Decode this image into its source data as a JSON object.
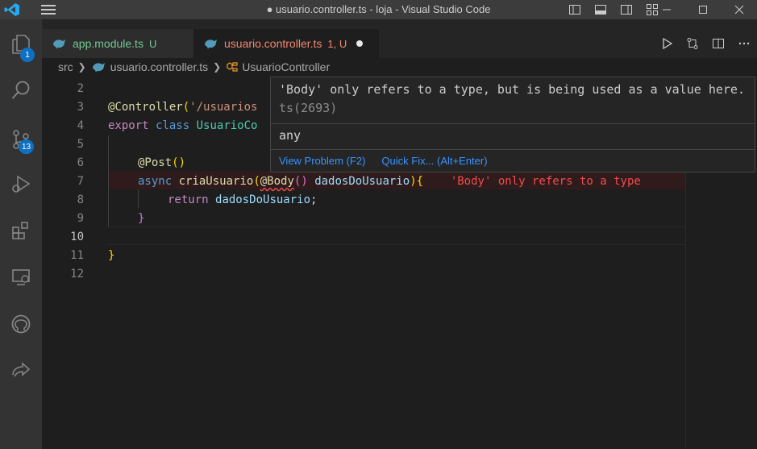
{
  "window": {
    "title": "● usuario.controller.ts - loja - Visual Studio Code"
  },
  "activity": {
    "explorer_badge": "1",
    "source_control_badge": "13"
  },
  "tabs": [
    {
      "name": "app.module.ts",
      "status": "U"
    },
    {
      "name": "usuario.controller.ts",
      "status": "1, U"
    }
  ],
  "breadcrumb": {
    "folder": "src",
    "file": "usuario.controller.ts",
    "symbol": "UsuarioController"
  },
  "editor": {
    "line_numbers": [
      "2",
      "3",
      "4",
      "5",
      "6",
      "7",
      "8",
      "9",
      "10",
      "11",
      "12"
    ],
    "active_line": "10",
    "line3": {
      "decorator": "@Controller",
      "open": "(",
      "string": "'/usuarios"
    },
    "line4": {
      "export": "export",
      "class": "class",
      "name": "UsuarioCo"
    },
    "line6": {
      "decorator": "@Post",
      "parens": "()"
    },
    "line7": {
      "async": "async",
      "fn": "criaUsuario",
      "open": "(",
      "decorator": "@Body",
      "dparens": "()",
      "param": "dadosDoUsuario",
      "close": ")",
      "brace": "{",
      "inline_error": "'Body' only refers to a type"
    },
    "line8": {
      "return": "return",
      "value": "dadosDoUsuario",
      "semi": ";"
    },
    "line9": {
      "brace": "}"
    },
    "line11": {
      "brace": "}"
    }
  },
  "hover": {
    "message": "'Body' only refers to a type, but is being used as a value here.",
    "code": "ts(2693)",
    "type": "any",
    "view_problem": "View Problem (F2)",
    "quick_fix": "Quick Fix... (Alt+Enter)"
  },
  "colors": {
    "accent": "#0e70c0",
    "error": "#f14c4c",
    "untracked": "#73c991",
    "link": "#3794ff"
  }
}
